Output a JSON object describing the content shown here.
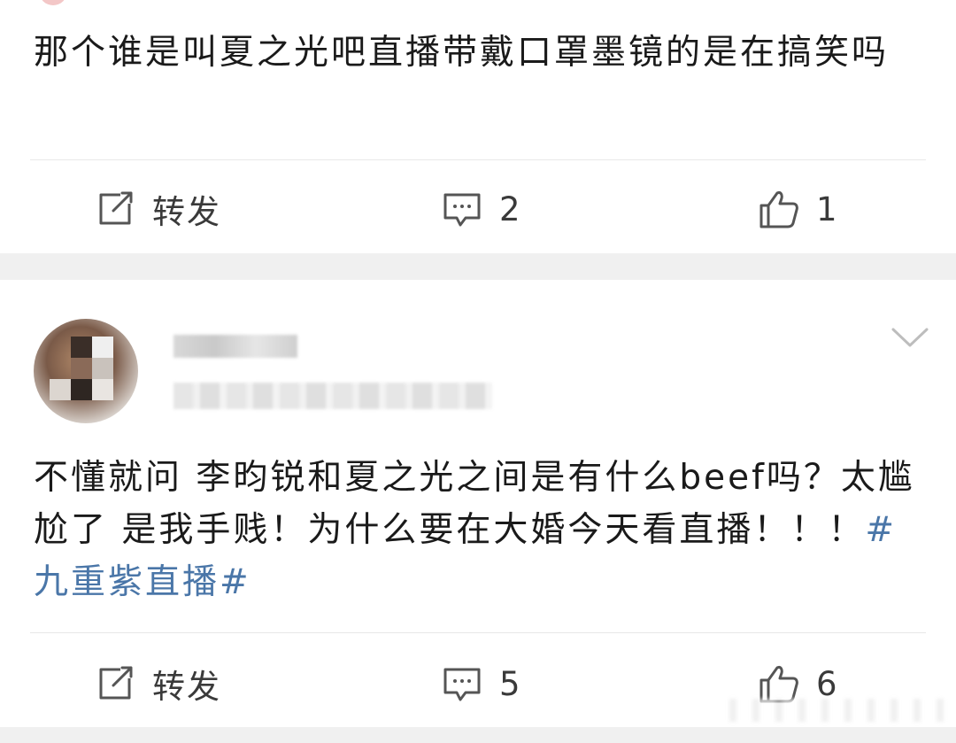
{
  "posts": [
    {
      "text": "那个谁是叫夏之光吧直播带戴口罩墨镜的是在搞笑吗",
      "hashtag": "",
      "actions": {
        "repost_label": "转发",
        "comment_count": "2",
        "like_count": "1"
      }
    },
    {
      "text": "不懂就问 李昀锐和夏之光之间是有什么beef吗？太尴尬了 是我手贱！为什么要在大婚今天看直播！！！",
      "hashtag": "#九重紫直播#",
      "actions": {
        "repost_label": "转发",
        "comment_count": "5",
        "like_count": "6"
      }
    }
  ],
  "icons": {
    "repost": "repost-icon",
    "comment": "comment-icon",
    "like": "thumbs-up-icon",
    "more": "chevron-down-icon"
  },
  "colors": {
    "hashtag": "#4a76a8",
    "text": "#1a1a1a",
    "background": "#f0f0f0",
    "card": "#ffffff"
  }
}
